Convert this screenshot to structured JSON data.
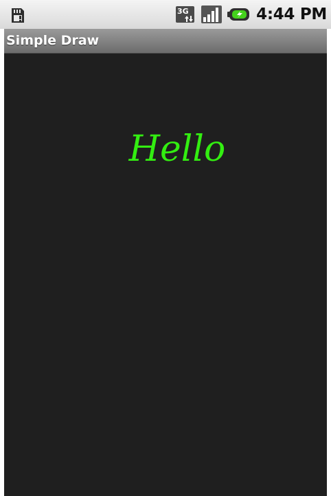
{
  "status_bar": {
    "icons": [
      "sd-card-icon",
      "3g-data-icon",
      "signal-strength-icon",
      "battery-charging-icon"
    ],
    "time": "4:44 PM"
  },
  "app": {
    "title": "Simple Draw"
  },
  "canvas": {
    "text": "Hello",
    "text_color": "#33ee11",
    "background": "#1f1f1f"
  }
}
